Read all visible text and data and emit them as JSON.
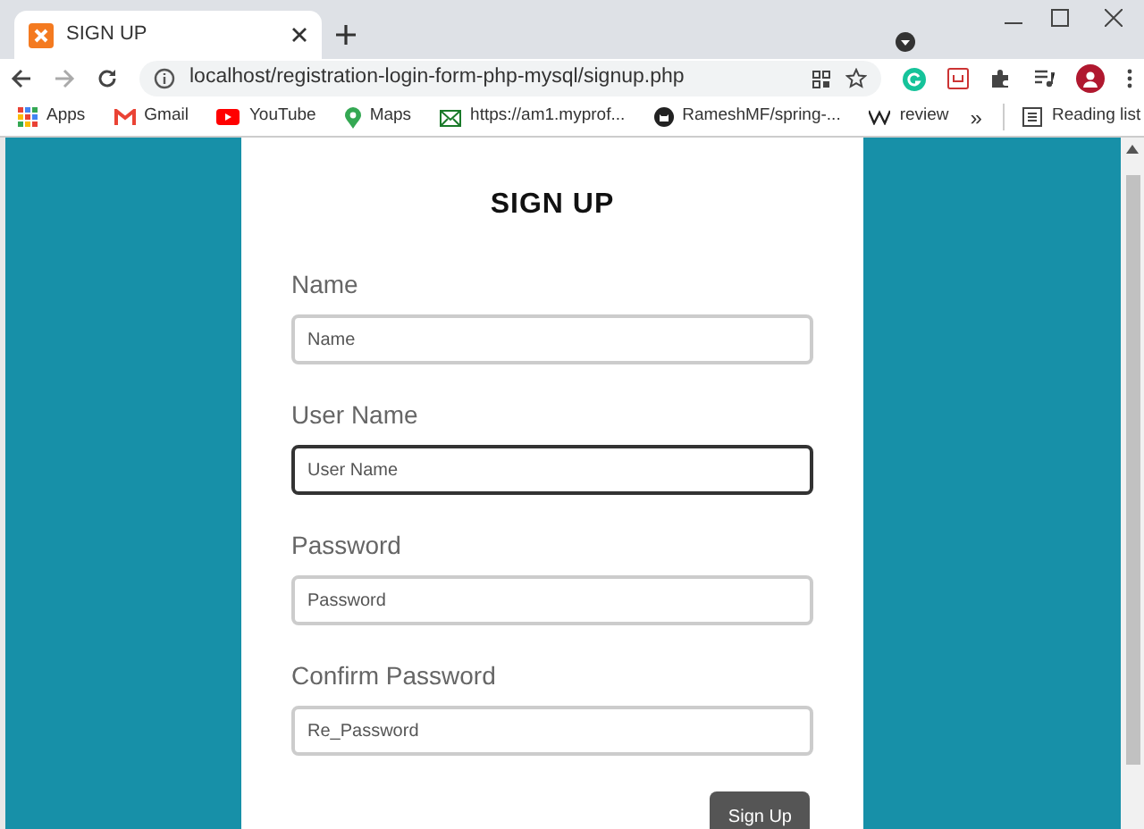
{
  "browser": {
    "tab_title": "SIGN UP",
    "url": "localhost/registration-login-form-php-mysql/signup.php",
    "bookmarks": [
      {
        "kind": "apps",
        "label": "Apps"
      },
      {
        "kind": "gmail",
        "label": "Gmail"
      },
      {
        "kind": "youtube",
        "label": "YouTube"
      },
      {
        "kind": "maps",
        "label": "Maps"
      },
      {
        "kind": "mail",
        "label": "https://am1.myprof..."
      },
      {
        "kind": "github",
        "label": "RameshMF/spring-..."
      },
      {
        "kind": "wiki",
        "label": "review"
      }
    ],
    "overflow": "»",
    "reading_list": "Reading list"
  },
  "form": {
    "title": "SIGN UP",
    "fields": [
      {
        "label": "Name",
        "placeholder": "Name",
        "focused": false
      },
      {
        "label": "User Name",
        "placeholder": "User Name",
        "focused": true
      },
      {
        "label": "Password",
        "placeholder": "Password",
        "focused": false
      },
      {
        "label": "Confirm Password",
        "placeholder": "Re_Password",
        "focused": false
      }
    ],
    "submit": "Sign Up"
  }
}
